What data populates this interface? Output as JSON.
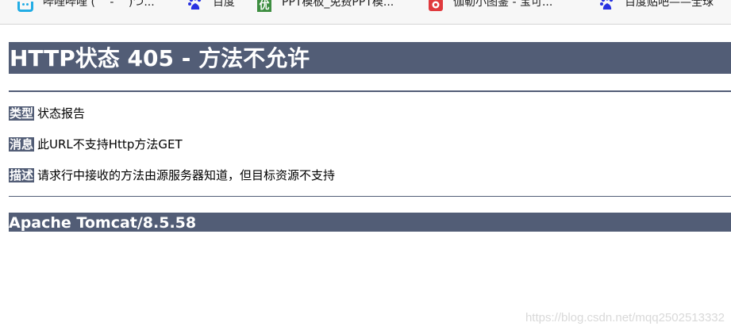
{
  "bookmarks": [
    {
      "label": "哔哩哔哩 ( ゜- ゜)つ...",
      "icon": "bilibili-icon"
    },
    {
      "label": "百度",
      "icon": "baidu-icon"
    },
    {
      "label": "PPT模板_免费PPT模...",
      "icon": "you-icon"
    },
    {
      "label": "伽勒小图鉴 - 宝可...",
      "icon": "jielin-icon"
    },
    {
      "label": "百度贴吧——全球",
      "icon": "baidu-icon"
    }
  ],
  "page": {
    "title": "HTTP状态 405 - 方法不允许",
    "rows": [
      {
        "label": "类型",
        "value": "状态报告"
      },
      {
        "label": "消息",
        "value": "此URL不支持Http方法GET"
      },
      {
        "label": "描述",
        "value": "请求行中接收的方法由源服务器知道，但目标资源不支持"
      }
    ],
    "footer": "Apache Tomcat/8.5.58"
  },
  "watermark": "https://blog.csdn.net/mqq2502513332",
  "colors": {
    "header_bg": "#525d76",
    "header_text": "#ffffff",
    "bilibili": "#23ade5",
    "baidu": "#2932e1",
    "you": "#3e8e41",
    "jielin": "#e03a3e"
  }
}
